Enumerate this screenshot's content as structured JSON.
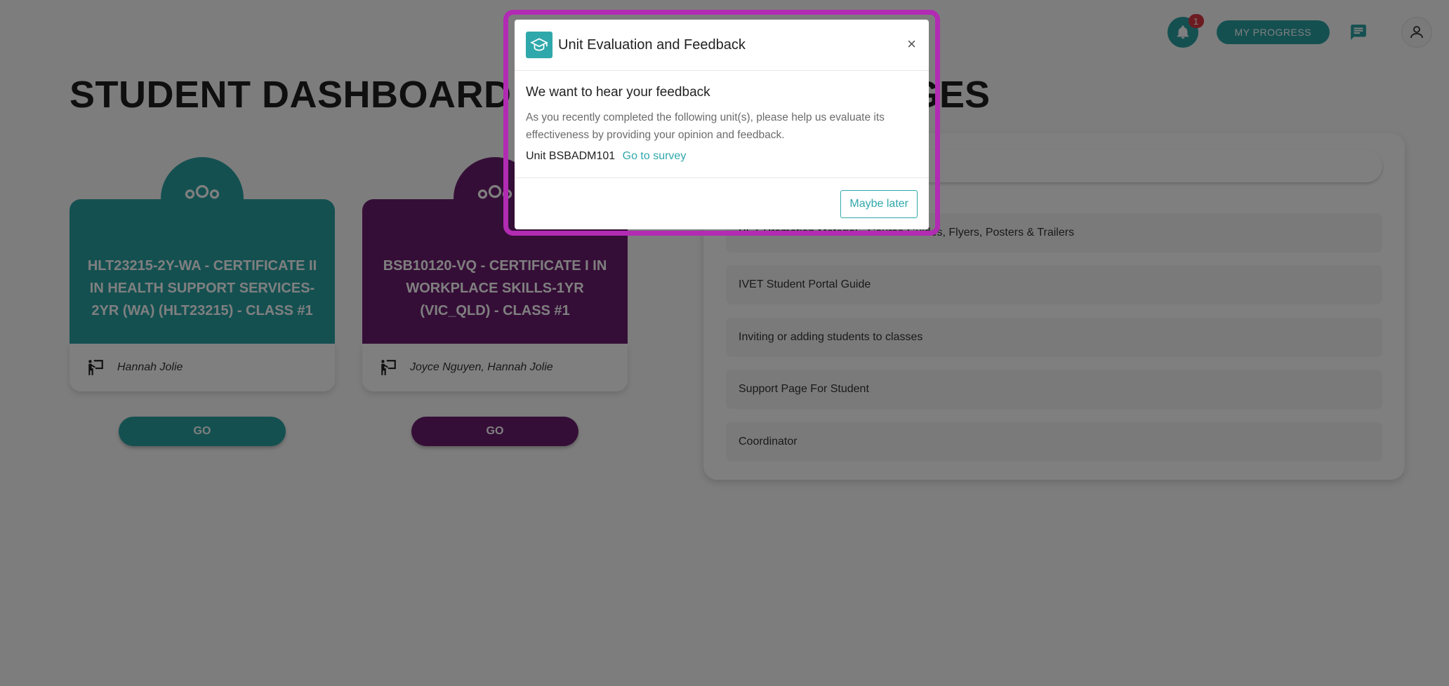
{
  "topbar": {
    "notification_count": "1",
    "my_progress_label": "MY PROGRESS"
  },
  "dashboard": {
    "title": "STUDENT DASHBOARD",
    "pages_title_partial": "GES"
  },
  "courses": [
    {
      "title": "HLT23215-2Y-WA - CERTIFICATE II IN HEALTH SUPPORT SERVICES-2YR (WA) (HLT23215) - CLASS #1",
      "teacher": "Hannah Jolie",
      "go_label": "GO",
      "color": "#2aa1a3"
    },
    {
      "title": "BSB10120-VQ - CERTIFICATE I IN WORKPLACE SKILLS-1YR (VIC_QLD) - CLASS #1",
      "teacher": "Joyce Nguyen, Hannah Jolie",
      "go_label": "GO",
      "color": "#6a1c6f"
    }
  ],
  "pages": [
    "VET Promotion Material - Course Guides, Flyers, Posters & Trailers",
    "IVET Student Portal Guide",
    "Inviting or adding students to classes",
    "Support Page For Student",
    "Coordinator"
  ],
  "modal": {
    "title": "Unit Evaluation and Feedback",
    "close_label": "×",
    "heading": "We want to hear your feedback",
    "text": "As you recently completed the following unit(s), please help us evaluate its effectiveness by providing your opinion and feedback.",
    "unit": "Unit BSBADM101",
    "survey_link": "Go to survey",
    "later_label": "Maybe later"
  },
  "colors": {
    "teal": "#2aa1a3",
    "purple": "#6a1c6f",
    "highlight": "#b22bb3",
    "badge": "#d93640"
  }
}
